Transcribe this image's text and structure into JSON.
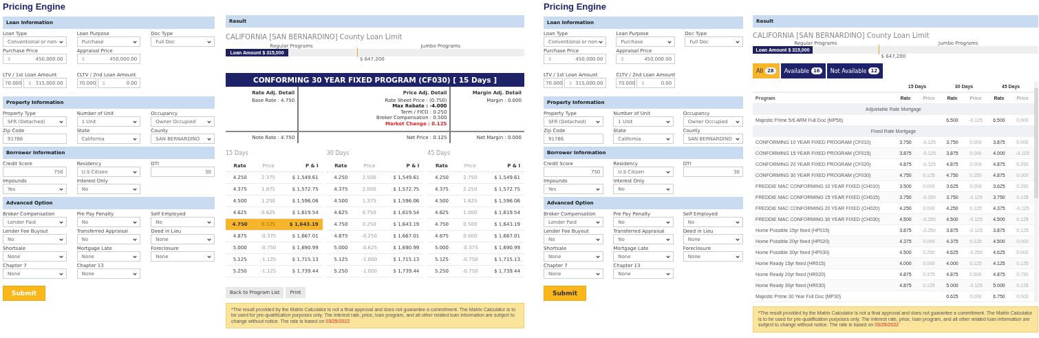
{
  "screens": [
    {
      "title": "Pricing Engine",
      "form": [
        {
          "heading": "Loan Information",
          "rows": [
            [
              {
                "kind": "select",
                "label": "Loan Type",
                "value": "Conventional or non-"
              },
              {
                "kind": "select",
                "label": "Loan Purpose",
                "value": "Purchase"
              },
              {
                "kind": "select",
                "label": "Doc Type",
                "value": "Full Doc"
              }
            ],
            [
              {
                "kind": "money",
                "label": "Purchase Price",
                "symbol": "$",
                "value": "450,000.00"
              },
              {
                "kind": "money",
                "label": "Appraisal Price",
                "symbol": "$",
                "value": "450,000.00"
              }
            ],
            [
              {
                "kind": "ltv",
                "label": "LTV / 1st Loan Amount",
                "ratio": "70.000",
                "symbol": "$",
                "value": "315,000.00"
              },
              {
                "kind": "ltv",
                "label": "CLTV / 2nd Loan Amount",
                "ratio": "70.000",
                "symbol": "$",
                "value": "0.00"
              }
            ]
          ]
        },
        {
          "heading": "Property Information",
          "rows": [
            [
              {
                "kind": "select",
                "label": "Property Type",
                "value": "SFR (Detached)"
              },
              {
                "kind": "select",
                "label": "Number of Unit",
                "value": "1 Unit"
              },
              {
                "kind": "select",
                "label": "Occupancy",
                "value": "Owner Occupied"
              }
            ],
            [
              {
                "kind": "text",
                "label": "Zip Code",
                "value": "91786"
              },
              {
                "kind": "select",
                "label": "State",
                "value": "California"
              },
              {
                "kind": "select",
                "label": "County",
                "value": "SAN BERNARDINO"
              }
            ]
          ]
        },
        {
          "heading": "Borrower Information",
          "rows": [
            [
              {
                "kind": "number",
                "label": "Credit Score",
                "value": "750"
              },
              {
                "kind": "select",
                "label": "Residency",
                "value": "U.S Citizen"
              },
              {
                "kind": "number",
                "label": "DTI",
                "value": "30"
              }
            ],
            [
              {
                "kind": "select",
                "label": "Impounds",
                "value": "Yes"
              },
              {
                "kind": "select",
                "label": "Interest Only",
                "value": "No"
              }
            ]
          ]
        },
        {
          "heading": "Advanced Option",
          "rows": [
            [
              {
                "kind": "select",
                "label": "Broker Compensation",
                "value": "Lender Paid"
              },
              {
                "kind": "select",
                "label": "Pre Pay Penalty",
                "value": "No"
              },
              {
                "kind": "select",
                "label": "Self Employed",
                "value": "No"
              }
            ],
            [
              {
                "kind": "select",
                "label": "Lender Fee Buyout",
                "value": "No"
              },
              {
                "kind": "select",
                "label": "Transferred Appraisal",
                "value": "No"
              },
              {
                "kind": "select",
                "label": "Deed in Lieu",
                "value": "None"
              }
            ],
            [
              {
                "kind": "select",
                "label": "Shortsale",
                "value": "None"
              },
              {
                "kind": "select",
                "label": "Mortgage Late",
                "value": "None"
              },
              {
                "kind": "select",
                "label": "Foreclosure",
                "value": "None"
              }
            ],
            [
              {
                "kind": "select",
                "label": "Chapter 7",
                "value": "None"
              },
              {
                "kind": "select",
                "label": "Chapter 13",
                "value": "None"
              }
            ]
          ]
        }
      ],
      "submit": "Submit",
      "result": {
        "kind": "detail",
        "heading": "Result",
        "loan_limit": {
          "title": "CALIFORNIA [SAN BERNARDINO] County Loan Limit",
          "segments": [
            "Regular Programs",
            "Jumbo Programs"
          ],
          "loan_label": "Loan Amount $ 315,000",
          "level": 0.21,
          "limit": "$ 647,200"
        },
        "program": {
          "title": "CONFORMING 30 YEAR FIXED PROGRAM (CF030) [ 15 Days ]",
          "columns": [
            {
              "heading": "Rate Adj. Detail",
              "lines": [
                {
                  "kind": "plain",
                  "text": "Base Rate : 4.750"
                }
              ],
              "total": "Note Rate : 4.750"
            },
            {
              "heading": "Price Adj. Detail",
              "lines": [
                {
                  "kind": "plain",
                  "text": "Rate Sheet Price : (0.750)"
                },
                {
                  "kind": "strong",
                  "text": "Max Rebate : -4.000"
                },
                {
                  "kind": "plain",
                  "text": "Term / FICO : 0.250"
                },
                {
                  "kind": "plain",
                  "text": "Broker Compensation : 0.500"
                },
                {
                  "kind": "alert",
                  "text": "Market Change : 0.125"
                }
              ],
              "total": "Net Price : 0.125"
            },
            {
              "heading": "Margin Adj. Detail",
              "lines": [
                {
                  "kind": "plain",
                  "text": "Margin : 0.000"
                }
              ],
              "total": "Net Margin : 0.000"
            }
          ]
        },
        "terms": [
          {
            "title": "15 Days",
            "headers": [
              "Rate",
              "Price",
              "P & I"
            ],
            "rows": [
              {
                "rate": "4.250",
                "price": "2.375",
                "payment": "$ 1,549.61",
                "selected": false
              },
              {
                "rate": "4.375",
                "price": "1.875",
                "payment": "$ 1,572.75",
                "selected": false
              },
              {
                "rate": "4.500",
                "price": "1.250",
                "payment": "$ 1,596.06",
                "selected": false
              },
              {
                "rate": "4.625",
                "price": "0.625",
                "payment": "$ 1,619.54",
                "selected": false
              },
              {
                "rate": "4.750",
                "price": "0.125",
                "payment": "$ 1,643.19",
                "selected": true
              },
              {
                "rate": "4.875",
                "price": "-0.375",
                "payment": "$ 1,667.01",
                "selected": false
              },
              {
                "rate": "5.000",
                "price": "-0.750",
                "payment": "$ 1,690.99",
                "selected": false
              },
              {
                "rate": "5.125",
                "price": "-1.125",
                "payment": "$ 1,715.13",
                "selected": false
              },
              {
                "rate": "5.250",
                "price": "-1.125",
                "payment": "$ 1,739.44",
                "selected": false
              }
            ]
          },
          {
            "title": "30 Days",
            "headers": [
              "Rate",
              "Price",
              "P & I"
            ],
            "rows": [
              {
                "rate": "4.250",
                "price": "2.500",
                "payment": "$ 1,549.61",
                "selected": false
              },
              {
                "rate": "4.375",
                "price": "2.000",
                "payment": "$ 1,572.75",
                "selected": false
              },
              {
                "rate": "4.500",
                "price": "1.375",
                "payment": "$ 1,596.06",
                "selected": false
              },
              {
                "rate": "4.625",
                "price": "0.750",
                "payment": "$ 1,619.54",
                "selected": false
              },
              {
                "rate": "4.750",
                "price": "0.250",
                "payment": "$ 1,643.19",
                "selected": false
              },
              {
                "rate": "4.875",
                "price": "-0.250",
                "payment": "$ 1,667.01",
                "selected": false
              },
              {
                "rate": "5.000",
                "price": "-0.625",
                "payment": "$ 1,690.99",
                "selected": false
              },
              {
                "rate": "5.125",
                "price": "-1.000",
                "payment": "$ 1,715.13",
                "selected": false
              },
              {
                "rate": "5.250",
                "price": "-1.000",
                "payment": "$ 1,739.44",
                "selected": false
              }
            ]
          },
          {
            "title": "45 Days",
            "headers": [
              "Rate",
              "Price",
              "P & I"
            ],
            "rows": [
              {
                "rate": "4.250",
                "price": "2.750",
                "payment": "$ 1,549.61",
                "selected": false
              },
              {
                "rate": "4.375",
                "price": "2.250",
                "payment": "$ 1,572.75",
                "selected": false
              },
              {
                "rate": "4.500",
                "price": "1.625",
                "payment": "$ 1,596.06",
                "selected": false
              },
              {
                "rate": "4.625",
                "price": "1.000",
                "payment": "$ 1,619.54",
                "selected": false
              },
              {
                "rate": "4.750",
                "price": "0.500",
                "payment": "$ 1,643.19",
                "selected": false
              },
              {
                "rate": "4.875",
                "price": "0.000",
                "payment": "$ 1,667.01",
                "selected": false
              },
              {
                "rate": "5.000",
                "price": "-0.375",
                "payment": "$ 1,690.99",
                "selected": false
              },
              {
                "rate": "5.125",
                "price": "-0.750",
                "payment": "$ 1,715.13",
                "selected": false
              },
              {
                "rate": "5.250",
                "price": "-0.750",
                "payment": "$ 1,739.44",
                "selected": false
              }
            ]
          }
        ],
        "buttons": [
          "Back to Program List",
          "Print"
        ],
        "notice": {
          "text": "*The result provided by the Matrix Calculator is not a final approval and does not guarantee a commitment. The Matrix Calculator is to be used for pre-qualification purposes only. The interest rate, price, loan program, and all other related loan information are subject to change without notice. The rate is based on",
          "date": "03/25/2022"
        }
      }
    },
    {
      "title": "Pricing Engine",
      "form": [
        {
          "heading": "Loan Information",
          "rows": [
            [
              {
                "kind": "select",
                "label": "Loan Type",
                "value": "Conventional or non-"
              },
              {
                "kind": "select",
                "label": "Loan Purpose",
                "value": "Purchase"
              },
              {
                "kind": "select",
                "label": "Doc Type",
                "value": "Full Doc"
              }
            ],
            [
              {
                "kind": "money",
                "label": "Purchase Price",
                "symbol": "$",
                "value": "450,000.00"
              },
              {
                "kind": "money",
                "label": "Appraisal Price",
                "symbol": "$",
                "value": "450,000.00"
              }
            ],
            [
              {
                "kind": "ltv",
                "label": "LTV / 1st Loan Amount",
                "ratio": "70.000",
                "symbol": "$",
                "value": "315,000.00"
              },
              {
                "kind": "ltv",
                "label": "CLTV / 2nd Loan Amount",
                "ratio": "70.000",
                "symbol": "$",
                "value": "0.00"
              }
            ]
          ]
        },
        {
          "heading": "Property Information",
          "rows": [
            [
              {
                "kind": "select",
                "label": "Property Type",
                "value": "SFR (Detached)"
              },
              {
                "kind": "select",
                "label": "Number of Unit",
                "value": "1 Unit"
              },
              {
                "kind": "select",
                "label": "Occupancy",
                "value": "Owner Occupied"
              }
            ],
            [
              {
                "kind": "text",
                "label": "Zip Code",
                "value": "91786"
              },
              {
                "kind": "select",
                "label": "State",
                "value": "California"
              },
              {
                "kind": "select",
                "label": "County",
                "value": "SAN BERNARDINO"
              }
            ]
          ]
        },
        {
          "heading": "Borrower Information",
          "rows": [
            [
              {
                "kind": "number",
                "label": "Credit Score",
                "value": "750"
              },
              {
                "kind": "select",
                "label": "Residency",
                "value": "U.S Citizen"
              },
              {
                "kind": "number",
                "label": "DTI",
                "value": "30"
              }
            ],
            [
              {
                "kind": "select",
                "label": "Impounds",
                "value": "Yes"
              },
              {
                "kind": "select",
                "label": "Interest Only",
                "value": "No"
              }
            ]
          ]
        },
        {
          "heading": "Advanced Option",
          "rows": [
            [
              {
                "kind": "select",
                "label": "Broker Compensation",
                "value": "Lender Paid"
              },
              {
                "kind": "select",
                "label": "Pre Pay Penalty",
                "value": "No"
              },
              {
                "kind": "select",
                "label": "Self Employed",
                "value": "No"
              }
            ],
            [
              {
                "kind": "select",
                "label": "Lender Fee Buyout",
                "value": "No"
              },
              {
                "kind": "select",
                "label": "Transferred Appraisal",
                "value": "No"
              },
              {
                "kind": "select",
                "label": "Deed in Lieu",
                "value": "None"
              }
            ],
            [
              {
                "kind": "select",
                "label": "Shortsale",
                "value": "None"
              },
              {
                "kind": "select",
                "label": "Mortgage Late",
                "value": "None"
              },
              {
                "kind": "select",
                "label": "Foreclosure",
                "value": "None"
              }
            ],
            [
              {
                "kind": "select",
                "label": "Chapter 7",
                "value": "None"
              },
              {
                "kind": "select",
                "label": "Chapter 13",
                "value": "None"
              }
            ]
          ]
        }
      ],
      "submit": "Submit",
      "result": {
        "kind": "list",
        "heading": "Result",
        "loan_limit": {
          "title": "CALIFORNIA [SAN BERNARDINO] County Loan Limit",
          "segments": [
            "Regular Programs",
            "Jumbo Programs"
          ],
          "loan_label": "Loan Amount $ 315,000",
          "level": 0.21,
          "limit": "$ 647,200"
        },
        "filters": [
          {
            "label": "All",
            "count": "28",
            "selected": true
          },
          {
            "label": "Available",
            "count": "16",
            "selected": false
          },
          {
            "label": "Not Available",
            "count": "12",
            "selected": false
          }
        ],
        "programs": {
          "terms": [
            "15 Days",
            "30 Days",
            "45 Days"
          ],
          "headers": [
            "Program",
            "Rate",
            "Price",
            "Rate",
            "Price",
            "Rate",
            "Price"
          ],
          "rows": [
            {
              "kind": "group",
              "name": "Adjustable Rate Mortgage"
            },
            {
              "kind": "program",
              "name": "Majestic Prime 5/6 ARM Full Doc (MP56)",
              "d30": {
                "rate": "6.500",
                "price": "-0.125"
              },
              "d45": {
                "rate": "6.500",
                "price": "0.000"
              }
            },
            {
              "kind": "group",
              "name": "Fixed Rate Mortgage"
            },
            {
              "kind": "program",
              "name": "CONFORMING 10 YEAR FIXED PROGRAM (CF010)",
              "d15": {
                "rate": "3.750",
                "price": "-0.125"
              },
              "d30": {
                "rate": "3.750",
                "price": "0.000"
              },
              "d45": {
                "rate": "3.875",
                "price": "0.000"
              }
            },
            {
              "kind": "program",
              "name": "CONFORMING 15 YEAR FIXED PROGRAM (CF015)",
              "d15": {
                "rate": "3.875",
                "price": "-0.125"
              },
              "d30": {
                "rate": "3.875",
                "price": "0.000"
              },
              "d45": {
                "rate": "4.000",
                "price": "-0.125"
              }
            },
            {
              "kind": "program",
              "name": "CONFORMING 20 YEAR FIXED PROGRAM (CF020)",
              "d15": {
                "rate": "4.875",
                "price": "-0.125"
              },
              "d30": {
                "rate": "4.875",
                "price": "0.000"
              },
              "d45": {
                "rate": "4.875",
                "price": "0.250"
              }
            },
            {
              "kind": "program",
              "name": "CONFORMING 30 YEAR FIXED PROGRAM (CF030)",
              "d15": {
                "rate": "4.750",
                "price": "0.125"
              },
              "d30": {
                "rate": "4.750",
                "price": "0.250"
              },
              "d45": {
                "rate": "4.875",
                "price": "0.000"
              }
            },
            {
              "kind": "program",
              "name": "FREDDIE MAC CONFORMING 10 YEAR FIXED (CH010)",
              "d15": {
                "rate": "3.500",
                "price": "0.000"
              },
              "d30": {
                "rate": "3.625",
                "price": "0.000"
              },
              "d45": {
                "rate": "3.625",
                "price": "0.250"
              }
            },
            {
              "kind": "program",
              "name": "FREDDIE MAC CONFORMING 15 YEAR FIXED (CH015)",
              "d15": {
                "rate": "3.750",
                "price": "-0.250"
              },
              "d30": {
                "rate": "3.750",
                "price": "-0.125"
              },
              "d45": {
                "rate": "3.750",
                "price": "0.125"
              }
            },
            {
              "kind": "program",
              "name": "FREDDIE MAC CONFORMING 20 YEAR FIXED (CH020)",
              "d15": {
                "rate": "4.250",
                "price": "0.000"
              },
              "d30": {
                "rate": "4.250",
                "price": "0.125"
              },
              "d45": {
                "rate": "4.375",
                "price": "-0.125"
              }
            },
            {
              "kind": "program",
              "name": "FREDDIE MAC CONFORMING 30 YEAR FIXED (CH030)",
              "d15": {
                "rate": "4.500",
                "price": "-0.250"
              },
              "d30": {
                "rate": "4.500",
                "price": "-0.125"
              },
              "d45": {
                "rate": "4.500",
                "price": "0.125"
              }
            },
            {
              "kind": "program",
              "name": "Home Possible 15yr fixed (HP015)",
              "d15": {
                "rate": "3.875",
                "price": "-0.250"
              },
              "d30": {
                "rate": "3.875",
                "price": "-0.125"
              },
              "d45": {
                "rate": "3.875",
                "price": "0.125"
              }
            },
            {
              "kind": "program",
              "name": "Home Possible 20yr fixed (HP020)",
              "d15": {
                "rate": "4.375",
                "price": "0.000"
              },
              "d30": {
                "rate": "4.375",
                "price": "0.125"
              },
              "d45": {
                "rate": "4.500",
                "price": "0.000"
              }
            },
            {
              "kind": "program",
              "name": "Home Possible 30yr fixed (HP030)",
              "d15": {
                "rate": "4.500",
                "price": "0.250"
              },
              "d30": {
                "rate": "4.625",
                "price": "-0.250"
              },
              "d45": {
                "rate": "4.625",
                "price": "0.000"
              }
            },
            {
              "kind": "program",
              "name": "Home Ready 15yr fixed (HR015)",
              "d15": {
                "rate": "4.000",
                "price": "0.000"
              },
              "d30": {
                "rate": "4.000",
                "price": "0.125"
              },
              "d45": {
                "rate": "4.125",
                "price": "0.125"
              }
            },
            {
              "kind": "program",
              "name": "Home Ready 20yr fixed (HR020)",
              "d15": {
                "rate": "4.875",
                "price": "0.375"
              },
              "d30": {
                "rate": "4.875",
                "price": "0.500"
              },
              "d45": {
                "rate": "4.875",
                "price": "0.750"
              }
            },
            {
              "kind": "program",
              "name": "Home Ready 30yr fixed (HR030)",
              "d15": {
                "rate": "4.875",
                "price": "0.125"
              },
              "d30": {
                "rate": "5.000",
                "price": "-0.125"
              },
              "d45": {
                "rate": "5.000",
                "price": "0.125"
              }
            },
            {
              "kind": "program",
              "name": "Majestic Prime 30 Year Full Doc (MP30)",
              "d30": {
                "rate": "6.625",
                "price": "0.000"
              },
              "d45": {
                "rate": "6.750",
                "price": "0.000"
              }
            }
          ]
        },
        "notice": {
          "text": "*The result provided by the Matrix Calculator is not a final approval and does not guarantee a commitment. The Matrix Calculator is to be used for pre-qualification purposes only. The interest rate, price, loan program, and all other related loan information are subject to change without notice. The rate is based on",
          "date": "03/25/2022"
        }
      }
    }
  ]
}
